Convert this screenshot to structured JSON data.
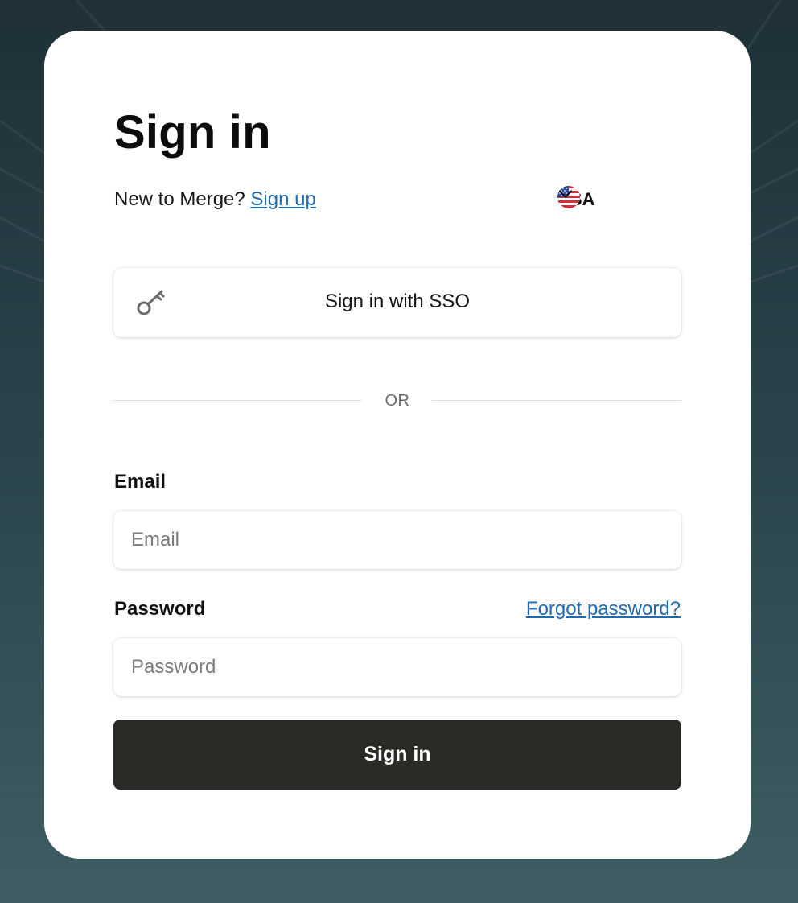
{
  "page": {
    "title": "Sign in"
  },
  "signup": {
    "prompt": "New to Merge? ",
    "link_label": "Sign up"
  },
  "region": {
    "label": "USA",
    "flag_icon": "us-flag-icon",
    "chevron_icon": "chevron-down-icon"
  },
  "sso": {
    "label": "Sign in with SSO",
    "icon": "key-icon"
  },
  "divider": {
    "label": "OR"
  },
  "email": {
    "label": "Email",
    "placeholder": "Email",
    "value": ""
  },
  "password": {
    "label": "Password",
    "placeholder": "Password",
    "value": "",
    "forgot_label": "Forgot password?"
  },
  "submit": {
    "label": "Sign in"
  },
  "colors": {
    "link": "#1f6bb0",
    "button_bg": "#2c2a26",
    "backdrop_top": "#1f3037",
    "backdrop_bottom": "#3f5d63"
  }
}
